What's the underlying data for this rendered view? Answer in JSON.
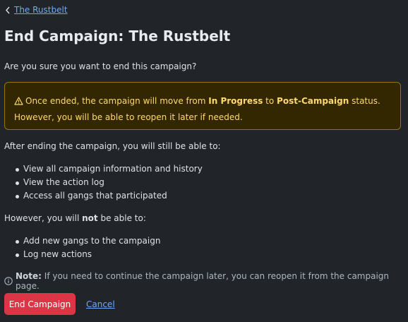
{
  "breadcrumb": {
    "back_label": "The Rustbelt"
  },
  "page": {
    "title": "End Campaign: The Rustbelt",
    "question": "Are you sure you want to end this campaign?"
  },
  "warning": {
    "text_before": "Once ended, the campaign will move from ",
    "status_from": "In Progress",
    "text_middle": " to ",
    "status_to": "Post-Campaign",
    "text_after": " status. However, you will be able to reopen it later if needed."
  },
  "can_section": {
    "intro": "After ending the campaign, you will still be able to:",
    "items": [
      "View all campaign information and history",
      "View the action log",
      "Access all gangs that participated"
    ]
  },
  "cannot_section": {
    "intro_before": "However, you will ",
    "intro_emphasis": "not",
    "intro_after": " be able to:",
    "items": [
      "Add new gangs to the campaign",
      "Log new actions"
    ]
  },
  "note": {
    "label": "Note:",
    "text": " If you need to continue the campaign later, you can reopen it from the campaign page."
  },
  "actions": {
    "end_label": "End Campaign",
    "cancel_label": "Cancel"
  },
  "colors": {
    "background": "#212529",
    "warning_bg": "#332701",
    "warning_border": "#997404",
    "warning_text": "#ffda6a",
    "danger": "#dc3545",
    "link": "#6ea8fe"
  },
  "icons": {
    "back": "chevron-left-icon",
    "warning": "warning-triangle-icon",
    "info": "info-circle-icon"
  }
}
